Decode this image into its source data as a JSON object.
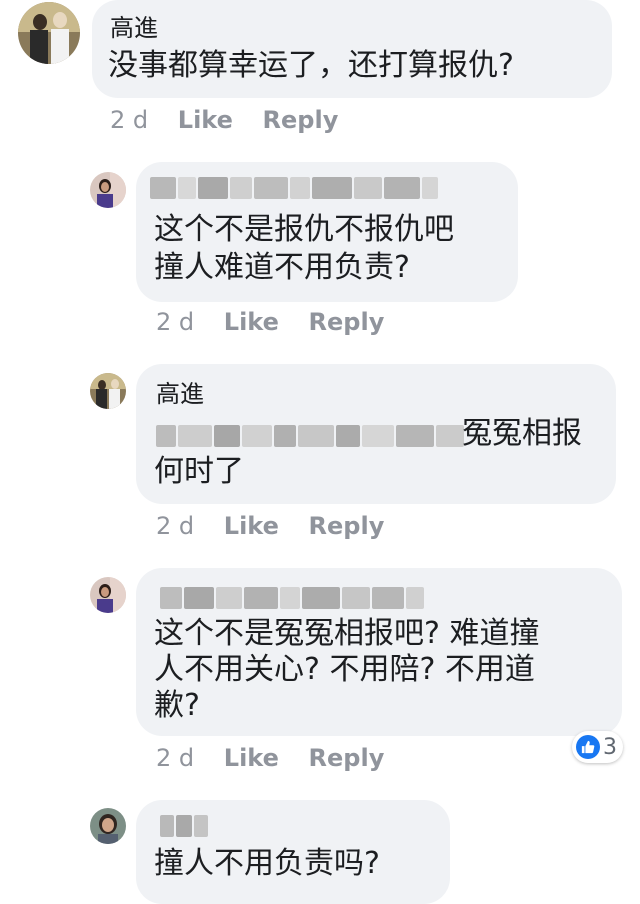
{
  "colors": {
    "bubble": "#f0f2f5",
    "meta_text": "#90949c",
    "like_blue": "#1877f2"
  },
  "comments": [
    {
      "author": "高進",
      "lines": [
        "没事都算幸运了，还打算报仇?"
      ],
      "time": "2 d",
      "like": "Like",
      "reply": "Reply"
    },
    {
      "author": "",
      "author_redacted": true,
      "lines": [
        "这个不是报仇不报仇吧",
        "撞人难道不用负责?"
      ],
      "time": "2 d",
      "like": "Like",
      "reply": "Reply"
    },
    {
      "author": "高進",
      "mention_redacted": true,
      "lines": [
        "冤冤相报",
        "何时了"
      ],
      "time": "2 d",
      "like": "Like",
      "reply": "Reply"
    },
    {
      "author": "",
      "author_redacted": true,
      "lines": [
        "这个不是冤冤相报吧? 难道撞",
        "人不用关心? 不用陪? 不用道",
        "歉?"
      ],
      "time": "2 d",
      "like": "Like",
      "reply": "Reply",
      "reaction": {
        "icon": "thumbs-up-icon",
        "count": "3"
      }
    },
    {
      "author": "",
      "author_redacted": true,
      "lines": [
        "撞人不用负责吗?"
      ]
    }
  ]
}
